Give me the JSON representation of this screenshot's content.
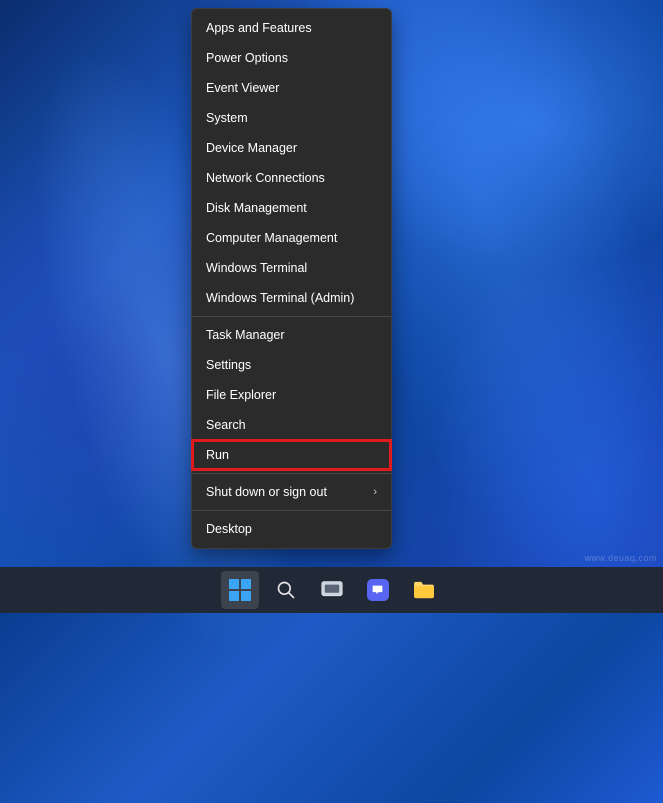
{
  "menu": {
    "group1": [
      "Apps and Features",
      "Power Options",
      "Event Viewer",
      "System",
      "Device Manager",
      "Network Connections",
      "Disk Management",
      "Computer Management",
      "Windows Terminal",
      "Windows Terminal (Admin)"
    ],
    "group2": [
      "Task Manager",
      "Settings",
      "File Explorer",
      "Search",
      "Run"
    ],
    "group3": [
      "Shut down or sign out"
    ],
    "group4": [
      "Desktop"
    ],
    "highlighted": "Run"
  },
  "watermark": "www.deuaq.com"
}
